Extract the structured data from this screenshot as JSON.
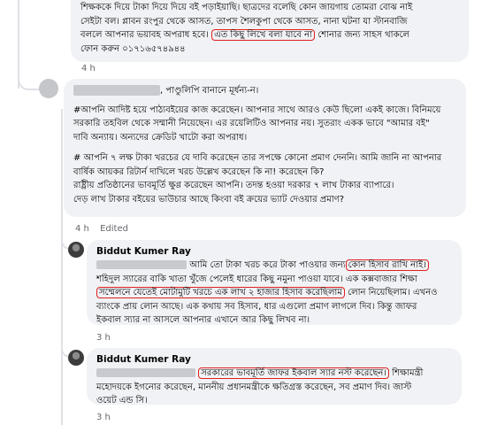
{
  "thread": {
    "top_comment": {
      "lines": [
        "শিক্ষককে দিয়ে টাকা দিয়ে দিয়ে বই পড়াইয়াছি। ছাত্রদের বলেছি কোন জায়গায় তোমরা বোঝ নাই",
        "সেইটা বল। প্লাবন রংপুর থেকে আসত, তাপস শৈলকুপা থেকে আসত, নানা ঘটনা যা স্টানবাজি",
        "বললে আপনার ভয়াবহ অপরাধ হবে।",
        "এত কিছু লিখে বলা যাবে না",
        "শোনার জন্য সাহস থাকলে",
        "ফোন করুন ০১৭১৬৫৭৪৯৪৪"
      ],
      "time": "4 h"
    },
    "reply_1": {
      "first_line_suffix": ", পাণ্ডুলিপি বানানে মূর্ধন্য-ন।",
      "p1": [
        "#আপনি আদিষ্ট হয়ে পাঠ্যবইয়ের কাজ করেছেন। আপনার সাথে আরও কেউ ছিলো একই কাজে। বিনিময়ে",
        "সরকারি তহবিল থেকে সম্মানী নিয়েছেন। এর রয়েলিটিও আপনার নয়। সুতরাং একক ভাবে \"আমার বই\"",
        "দাবি অন্যায়। অন্যদের ক্রেডিট খাটো করা অপরাধ।"
      ],
      "p2": [
        "# আপনি ৭ লক্ষ টাকা খরচের যে দাবি করেছেন তার সপক্ষে কোনো প্রমাণ দেননি। আমি জানি না আপনার",
        "বার্ষিক আয়কর রিটার্ন দাখিলে খরচ উল্লেখ করেছেন কি না! করেছেন কি?",
        "রাষ্ট্রীয় প্রতিষ্ঠানের ভাবমূর্তি ক্ষুণ্ণ করেছেন আপনি। তদন্ত হওয়া দরকার ৭ লাখ টাকার ব্যাপারে।",
        "দেড় লাখ টাকার বইয়ের ভাউচার আছে কিংবা বই ক্রয়ের ভ্যাট দেওয়ার প্রমাণ?"
      ],
      "time": "4 h",
      "edited": "Edited"
    },
    "reply_2": {
      "author": "Biddut Kumer Ray",
      "line1_text": "আমি তো টাকা খরচ করে টাকা পাওয়ার জন্য",
      "line1_mark": "কোন হিসাব রাখি নাই।",
      "line2": "শহিদুল স্যারের বাকি খাতা খুঁজে পেলেই ধারের কিছু নমুনা পাওয়া যাবে। এক কক্সবাজার শিক্ষা",
      "line3_mark": "সম্মেলনে যেতেই মোটামুটি খরচে এক লাখ ২ হাজার হিসাব করেছিলাম",
      "line3_rest": "লোন নিয়েছিলাম। এখনও",
      "line4": "ব্যাংকে প্রায় লোন আছে। এক কথায় সব হিসাব, ধার এগুলো প্রমাণ লাগলে দিব। কিন্তু জাফর",
      "line5": "ইকবাল স্যার না আসলে আপনার এখানে আর কিছু লিখব না।",
      "time": "3 h"
    },
    "reply_3": {
      "author": "Biddut Kumer Ray",
      "line1_mark": "সরকারের ভাবমূর্তি জাফর ইকবাল স্যার নস্ট করেছেন।",
      "line1_rest": "শিক্ষামন্ত্রী",
      "line2": "মহোদয়কে ইগনোর করেছেন, মাননীয় প্রধানমন্ত্রীকে ক্ষতিগ্রস্ত করেছেন, সব প্রমাণ দিব। জাস্ট",
      "line3": "ওয়েট এন্ড সি।",
      "time": "3 h"
    }
  },
  "colors": {
    "annotation": "#e0201e",
    "bubble": "#f0f2f5",
    "meta": "#65676b"
  }
}
